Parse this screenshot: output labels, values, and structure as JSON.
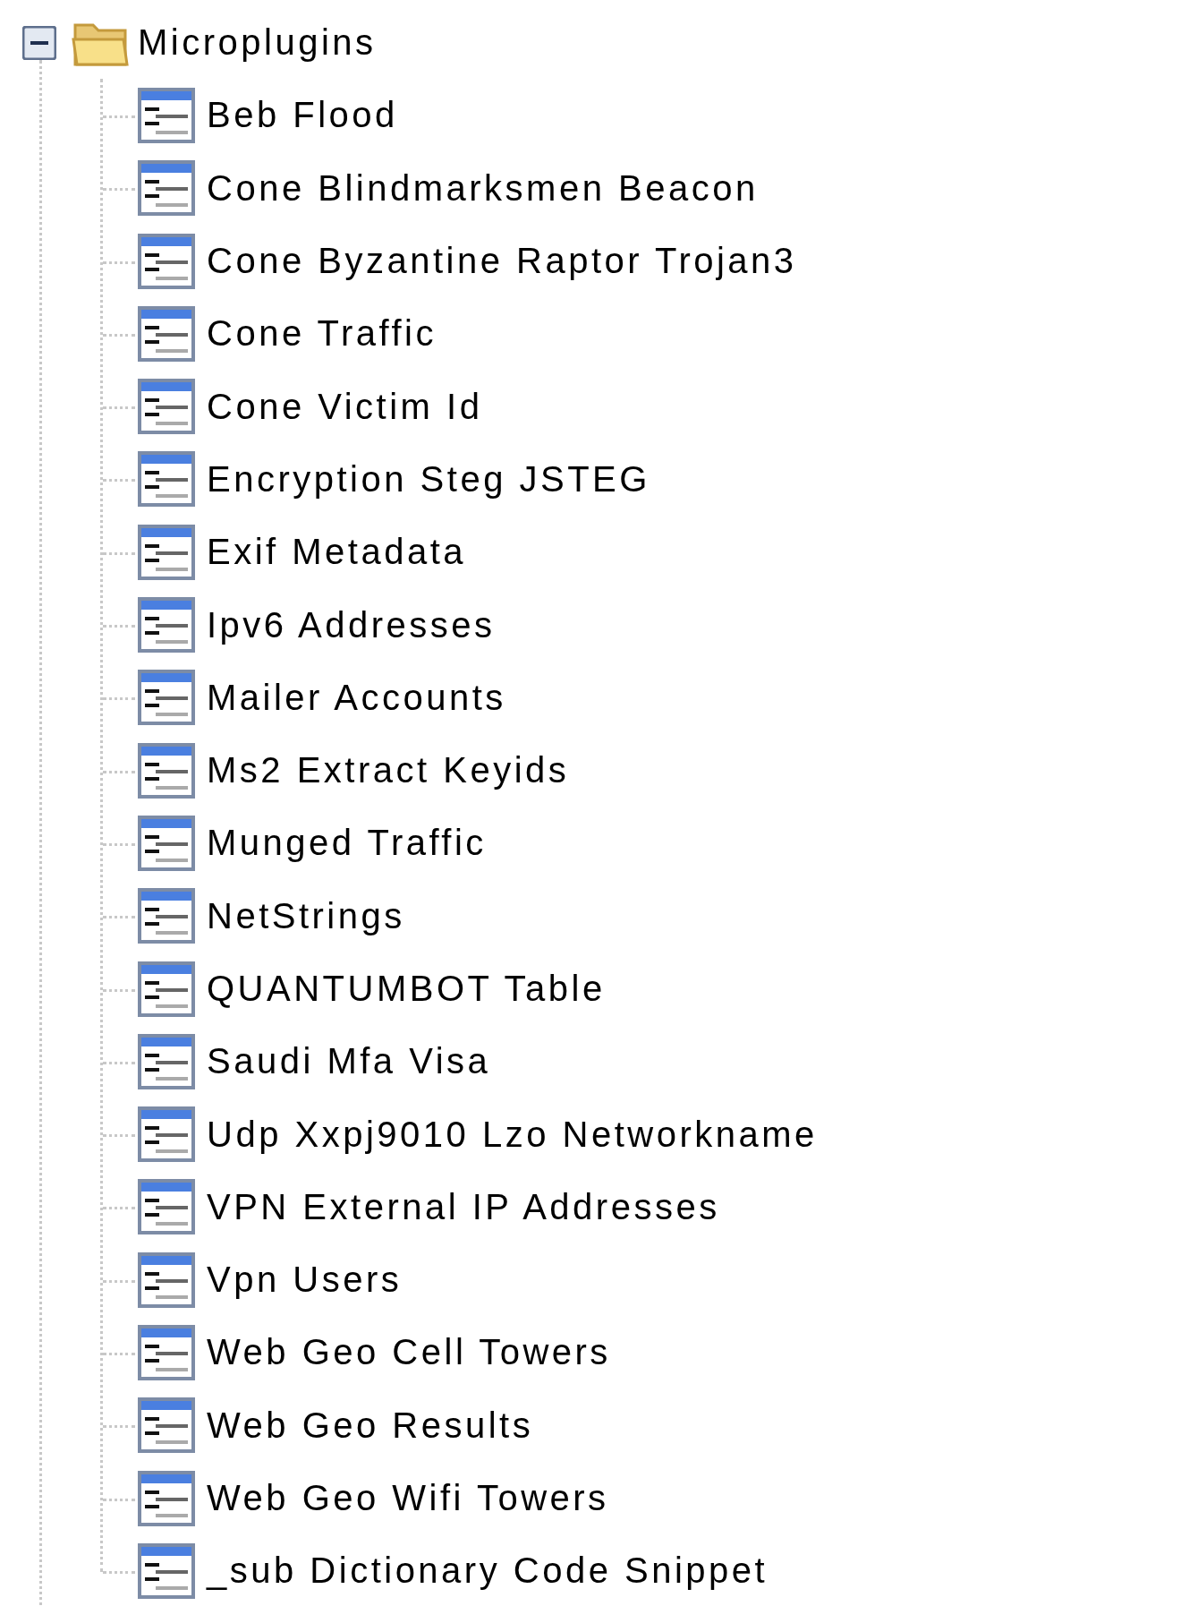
{
  "tree": {
    "label": "Microplugins",
    "expanded": true,
    "children": [
      {
        "label": "Beb Flood"
      },
      {
        "label": "Cone Blindmarksmen Beacon"
      },
      {
        "label": "Cone Byzantine Raptor Trojan3"
      },
      {
        "label": "Cone Traffic"
      },
      {
        "label": "Cone Victim Id"
      },
      {
        "label": "Encryption Steg JSTEG"
      },
      {
        "label": "Exif Metadata"
      },
      {
        "label": "Ipv6 Addresses"
      },
      {
        "label": "Mailer Accounts"
      },
      {
        "label": "Ms2 Extract Keyids"
      },
      {
        "label": "Munged Traffic"
      },
      {
        "label": "NetStrings"
      },
      {
        "label": "QUANTUMBOT Table"
      },
      {
        "label": "Saudi Mfa Visa"
      },
      {
        "label": "Udp Xxpj9010 Lzo Networkname"
      },
      {
        "label": "VPN External IP Addresses"
      },
      {
        "label": "Vpn Users"
      },
      {
        "label": "Web Geo Cell Towers"
      },
      {
        "label": "Web Geo Results"
      },
      {
        "label": "Web Geo Wifi Towers"
      },
      {
        "label": "_sub Dictionary Code Snippet"
      }
    ]
  }
}
